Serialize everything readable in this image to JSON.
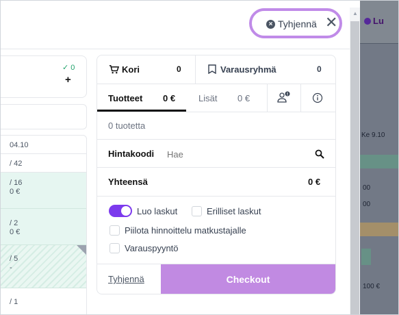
{
  "header": {
    "clear_label": "Tyhjennä",
    "close_icon": "close-icon",
    "clear_icon": "x-circle-icon"
  },
  "left": {
    "check_count": "✓ 0",
    "plus": "+",
    "rows": [
      "04.10",
      "/ 42",
      "/ 16",
      "0 €",
      "/ 2",
      "0 €",
      "/ 5",
      "-",
      "/ 1"
    ]
  },
  "cart": {
    "tab_kori": "Kori",
    "tab_kori_count": "0",
    "tab_group": "Varausryhmä",
    "tab_group_count": "0",
    "sub_products": "Tuotteet",
    "sub_products_value": "0 €",
    "sub_extras": "Lisät",
    "sub_extras_value": "0 €",
    "products_count": "0 tuotetta",
    "price_code_label": "Hintakoodi",
    "price_code_placeholder": "Hae",
    "total_label": "Yhteensä",
    "total_value": "0 €",
    "create_invoices": "Luo laskut",
    "separate_invoices": "Erilliset laskut",
    "hide_pricing": "Piilota hinnoittelu matkustajalle",
    "booking_request": "Varauspyyntö",
    "clear_link": "Tyhjennä",
    "checkout": "Checkout"
  },
  "right_strip": {
    "top_label": "Lu",
    "date_label": "Ke 9.10",
    "row1": "00",
    "row2": "00",
    "bottom": "100 €"
  },
  "colors": {
    "accent": "#7c3aed",
    "checkout_bg": "#c18ae2",
    "highlight": "#c08be8",
    "teal_row": "#e6f6f1"
  }
}
